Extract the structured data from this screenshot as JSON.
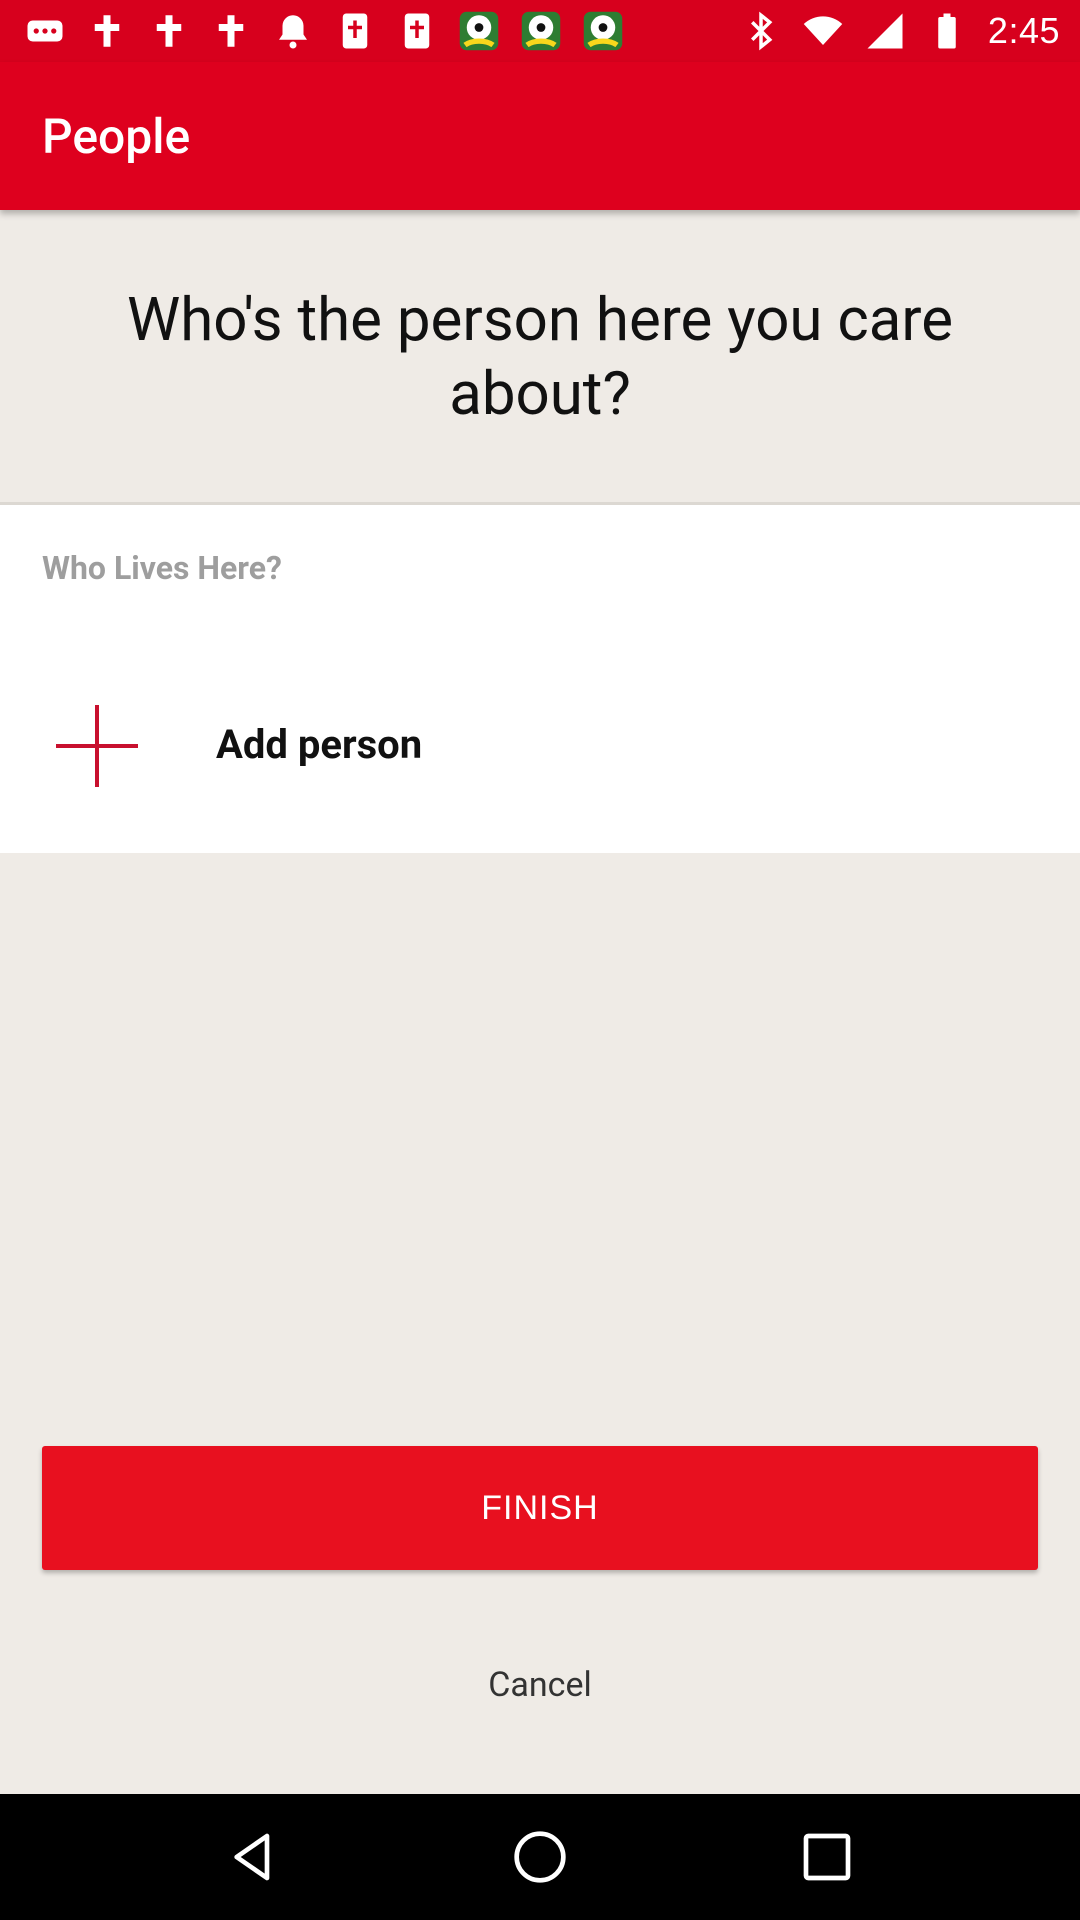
{
  "status_bar": {
    "time": "2:45",
    "icons": [
      "more-icon",
      "cross-icon",
      "cross-icon",
      "cross-icon",
      "bell-icon",
      "bible-icon",
      "bible-icon",
      "soccer-icon",
      "soccer-icon",
      "soccer-icon",
      "bluetooth-icon",
      "wifi-icon",
      "signal-icon",
      "battery-icon"
    ]
  },
  "app_bar": {
    "title": "People"
  },
  "question": {
    "text": "Who's the person here you care about?"
  },
  "card": {
    "section_label": "Who Lives Here?",
    "add_person_label": "Add person"
  },
  "actions": {
    "finish_label": "FINISH",
    "cancel_label": "Cancel"
  },
  "colors": {
    "status_bar": "#d7001d",
    "app_bar": "#de001e",
    "accent": "#e8101f",
    "background": "#efebe6"
  },
  "nav_bar": {
    "buttons": [
      "back-icon",
      "home-icon",
      "recents-icon"
    ]
  }
}
